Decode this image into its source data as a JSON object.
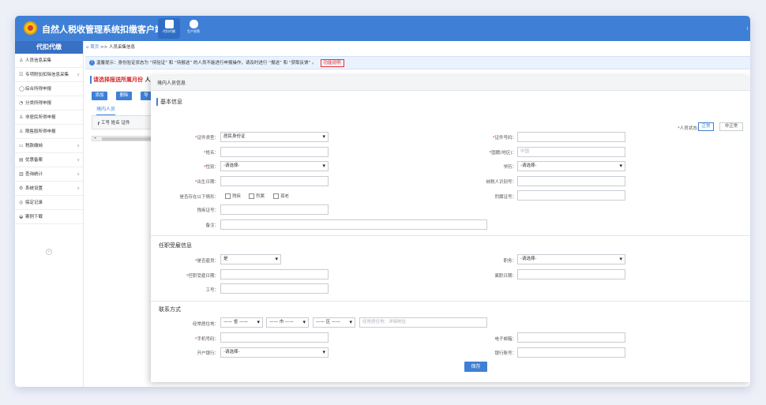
{
  "app": {
    "title": "自然人税收管理系统扣缴客户端",
    "top_right_mark": "I"
  },
  "toolbar": [
    {
      "label": "代扣代缴"
    },
    {
      "label": "生产经营"
    }
  ],
  "sidebar": {
    "header": "代扣代缴",
    "items": [
      {
        "label": "人员信息采集",
        "icon": "person-icon",
        "glyph": "♙",
        "chevron": ""
      },
      {
        "label": "专项附加扣除信息采集",
        "icon": "list-icon",
        "glyph": "☷",
        "chevron": "∨"
      },
      {
        "label": "综合所得申报",
        "icon": "circle-icon",
        "glyph": "◯",
        "chevron": ""
      },
      {
        "label": "分类所得申报",
        "icon": "clock-icon",
        "glyph": "◔",
        "chevron": ""
      },
      {
        "label": "非居民所得申报",
        "icon": "person-icon",
        "glyph": "♙",
        "chevron": ""
      },
      {
        "label": "限售股所得申报",
        "icon": "person-icon",
        "glyph": "♙",
        "chevron": ""
      },
      {
        "label": "税款缴纳",
        "icon": "card-icon",
        "glyph": "▭",
        "chevron": "∨"
      },
      {
        "label": "优惠备案",
        "icon": "doc-icon",
        "glyph": "▤",
        "chevron": "∨"
      },
      {
        "label": "查询统计",
        "icon": "chart-icon",
        "glyph": "▥",
        "chevron": "∨"
      },
      {
        "label": "系统设置",
        "icon": "gear-icon",
        "glyph": "⚙",
        "chevron": "∨"
      },
      {
        "label": "搞定记录",
        "icon": "circle-icon",
        "glyph": "◎",
        "chevron": ""
      },
      {
        "label": "案例下载",
        "icon": "download-icon",
        "glyph": "◒",
        "chevron": ""
      }
    ],
    "collapse_glyph": "«"
  },
  "breadcrumb": {
    "home": "首页",
    "sep": ">>",
    "current": "人员采集信息"
  },
  "notice": {
    "icon_glyph": "!",
    "text": "温馨提示：身份验证状态为 “待验证” 和 “待报送” 的人员不能进行申报操作，请及时进行 “报送” 和 “获取反馈” 。",
    "link": "功能说明"
  },
  "background_page": {
    "title": "请选择报送所属月份",
    "title_tail": "人",
    "buttons": [
      "添加",
      "删除",
      "导"
    ],
    "tab": "境内人员",
    "table_header": "┏  工号  姓名  证件",
    "scroll_arrow": "◂"
  },
  "modal": {
    "title": "境内人员信息",
    "sections": {
      "basic": "基本信息",
      "employment": "任职受雇信息",
      "contact": "联系方式"
    },
    "status": {
      "label": "人员状态:",
      "options": [
        "正常",
        "非正常"
      ],
      "selected": "正常"
    },
    "basic_fields": {
      "id_type": {
        "label": "证件类型",
        "value": "居民身份证"
      },
      "id_number": {
        "label": "证件号码",
        "value": ""
      },
      "name": {
        "label": "姓名",
        "value": ""
      },
      "nationality": {
        "label": "*国籍(地区)：",
        "value": "中国"
      },
      "gender": {
        "label": "性别",
        "value": "-请选择-"
      },
      "education": {
        "label": "学历：",
        "value": "-请选择-"
      },
      "birth_date": {
        "label": "出生日期",
        "value": ""
      },
      "taxpayer_id": {
        "label": "纳税人识别号：",
        "value": ""
      },
      "special_situation": {
        "label": "是否存在以下情形：",
        "options": [
          "残疾",
          "烈属",
          "孤老"
        ]
      },
      "martyr_cert": {
        "label": "烈属证号：",
        "value": ""
      },
      "disability_cert": {
        "label": "残疾证号：",
        "value": ""
      },
      "remark": {
        "label": "备注：",
        "value": ""
      }
    },
    "employment_fields": {
      "is_employee": {
        "label": "是否雇员",
        "value": "是"
      },
      "position": {
        "label": "职务：",
        "value": "-请选择-"
      },
      "hire_date": {
        "label": "任职受雇日期",
        "value": ""
      },
      "leave_date": {
        "label": "离职日期：",
        "value": ""
      },
      "employee_no": {
        "label": "工号：",
        "value": ""
      }
    },
    "contact_fields": {
      "residence": {
        "label": "经常居住地：",
        "province": "—— 省 ——",
        "city": "—— 市 ——",
        "district": "—— 区 ——",
        "detail_placeholder": "经常居住地：详细地址"
      },
      "mobile": {
        "label": "手机号码",
        "value": ""
      },
      "email": {
        "label": "电子邮箱：",
        "value": ""
      },
      "bank": {
        "label": "开户银行：",
        "value": "-请选择-"
      },
      "bank_account": {
        "label": "银行账号：",
        "value": ""
      }
    },
    "save_label": "保存"
  },
  "colors": {
    "primary": "#3f80d6",
    "required": "#e23b3b",
    "sidebar_header": "#3870c4"
  }
}
